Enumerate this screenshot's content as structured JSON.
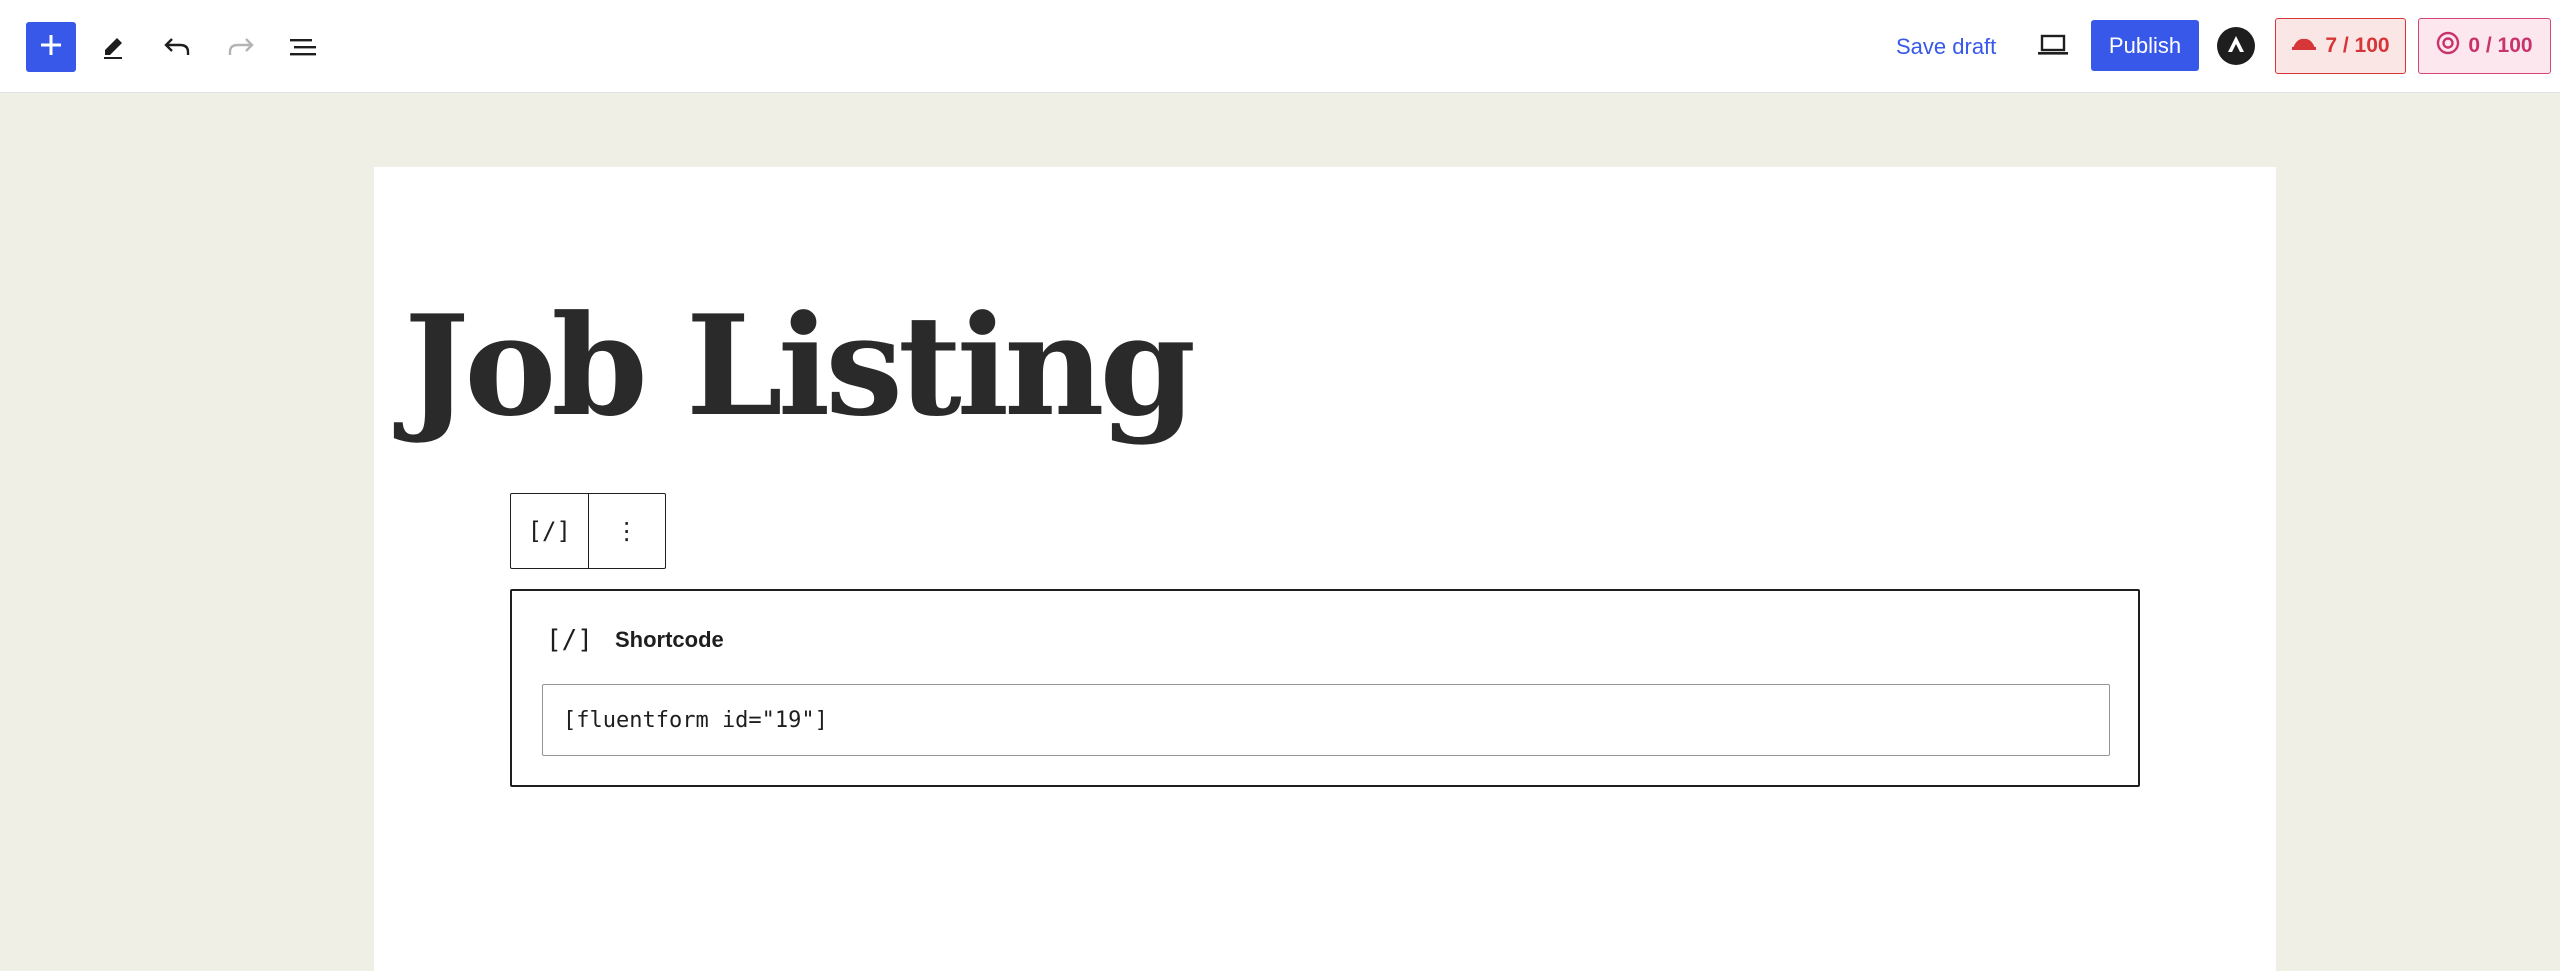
{
  "toolbar": {
    "add_block_icon": "plus-icon",
    "tools_icon": "pencil-icon",
    "undo_icon": "undo-icon",
    "redo_icon": "redo-icon",
    "document_overview_icon": "list-view-icon",
    "save_draft_label": "Save draft",
    "preview_icon": "laptop-icon",
    "publish_label": "Publish",
    "plugin_icon": "astra-logo-icon",
    "seo_score": "7 / 100",
    "seo_icon": "seo-hat-icon",
    "readability_score": "0 / 100",
    "readability_icon": "readability-icon"
  },
  "editor": {
    "title": "Job Listing",
    "block_toolbar": {
      "block_type_glyph": "[/]",
      "options_glyph": "⋮"
    },
    "shortcode_block": {
      "icon_glyph": "[/]",
      "label": "Shortcode",
      "value": "[fluentform id=\"19\"]"
    }
  },
  "colors": {
    "accent": "#3858e9",
    "canvas_background": "#f0efe6",
    "seo_badge": "#d63638",
    "readability_badge": "#c8336c"
  }
}
